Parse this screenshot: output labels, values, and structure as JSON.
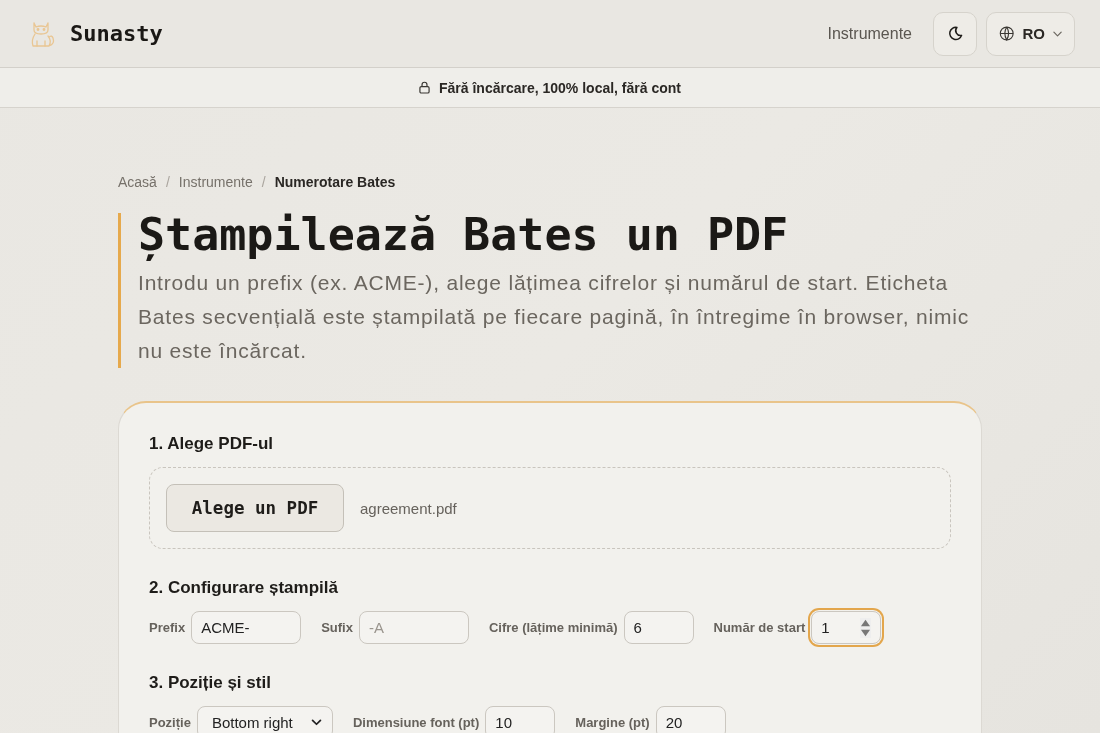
{
  "header": {
    "brand": "Sunasty",
    "nav": [
      {
        "label": "Instrumente"
      }
    ],
    "language": "RO"
  },
  "banner": {
    "text": "Fără încărcare, 100% local, fără cont"
  },
  "breadcrumb": [
    {
      "kind": "link",
      "label": "Acasă"
    },
    {
      "kind": "separator",
      "label": "/"
    },
    {
      "kind": "link",
      "label": "Instrumente"
    },
    {
      "kind": "separator",
      "label": "/"
    },
    {
      "kind": "current",
      "label": "Numerotare Bates"
    }
  ],
  "title": "Ștampilează Bates un PDF",
  "intro": "Introdu un prefix (ex. ACME-), alege lățimea cifrelor și numărul de start. Eticheta Bates secvențială este ștampilată pe fiecare pagină, în întregime în browser, nimic nu este încărcat.",
  "sections": [
    {
      "kind": "file",
      "title": "1. Alege PDF-ul",
      "button": "Alege un PDF",
      "file_name": "agreement.pdf"
    },
    {
      "kind": "fields",
      "title": "2. Configurare ștampilă",
      "fields": [
        {
          "kind": "text",
          "label": "Prefix",
          "value": "ACME-",
          "focused": false
        },
        {
          "kind": "text",
          "label": "Sufix",
          "placeholder": "-A",
          "focused": false
        },
        {
          "kind": "number",
          "label": "Cifre (lățime minimă)",
          "value": "6",
          "focused": false
        },
        {
          "kind": "number",
          "label": "Număr de start",
          "value": "1",
          "focused": true
        }
      ]
    },
    {
      "kind": "fields",
      "title": "3. Poziție și stil",
      "fields": [
        {
          "kind": "select",
          "label": "Poziție",
          "value": "Bottom right",
          "focused": false
        },
        {
          "kind": "number",
          "label": "Dimensiune font (pt)",
          "value": "10",
          "focused": false
        },
        {
          "kind": "number",
          "label": "Margine (pt)",
          "value": "20",
          "focused": false
        }
      ]
    }
  ]
}
